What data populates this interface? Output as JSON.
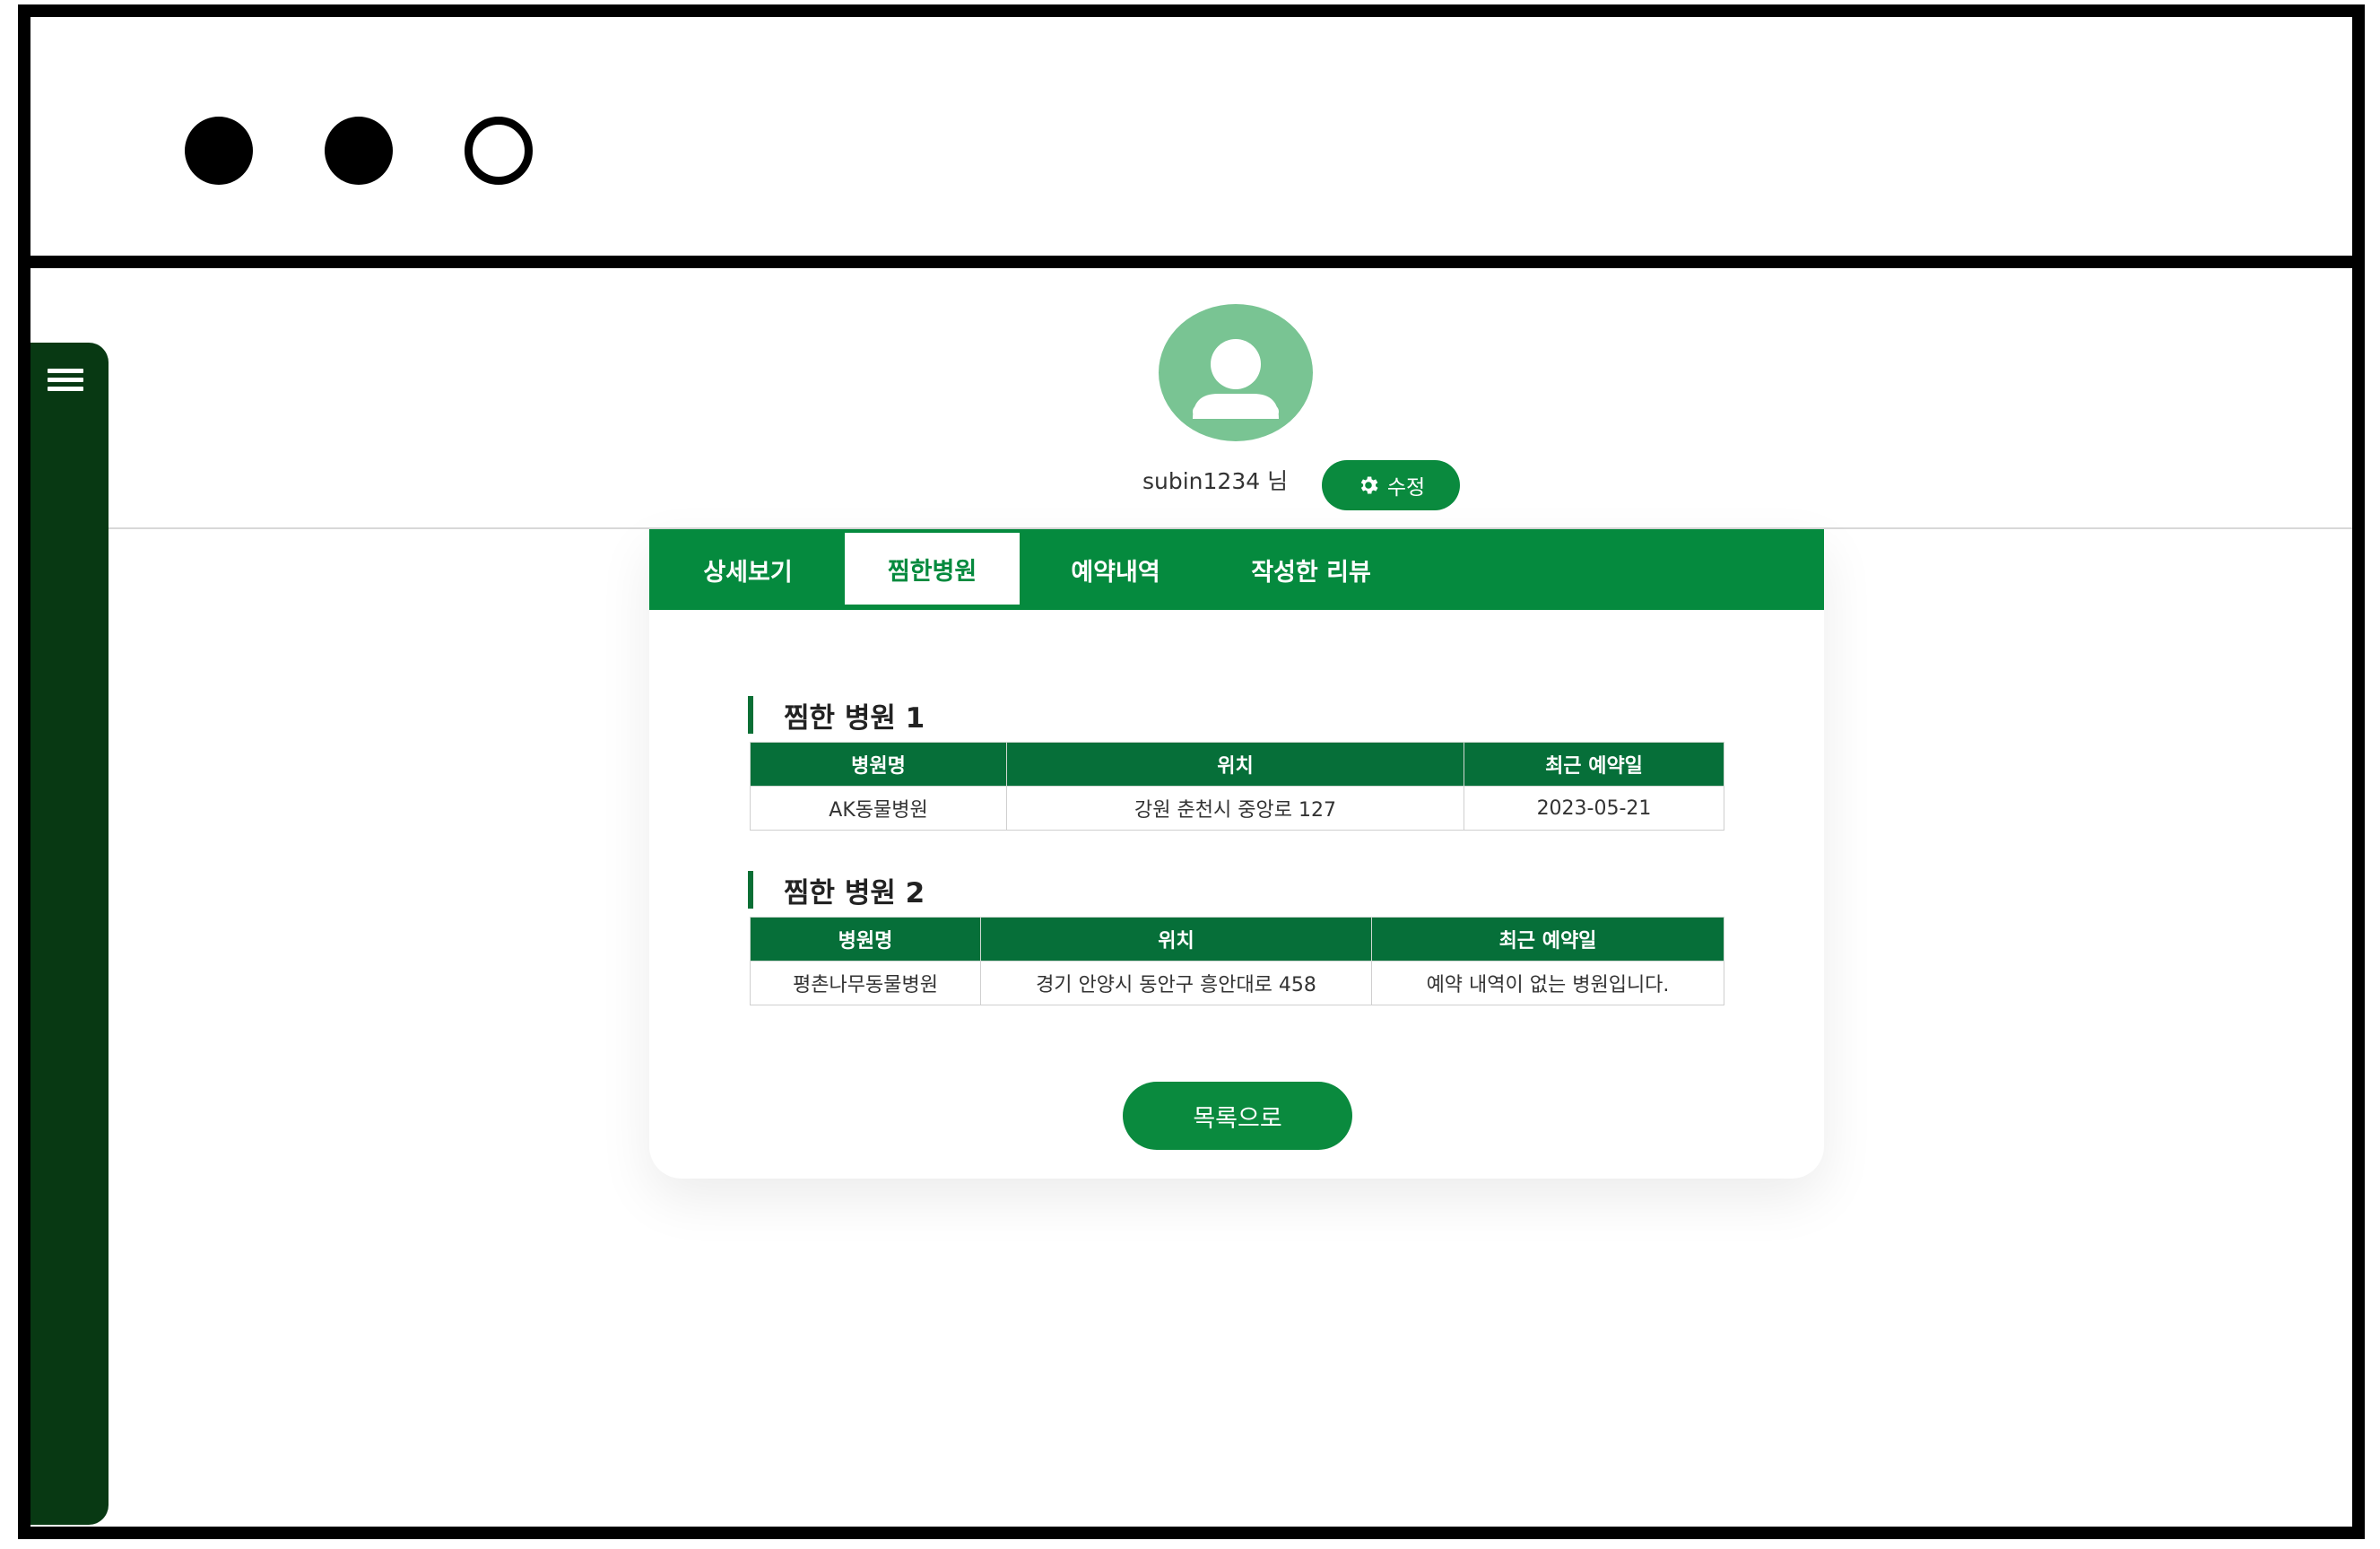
{
  "profile": {
    "username": "subin1234 님",
    "edit_label": "수정"
  },
  "tabs": [
    {
      "label": "상세보기",
      "active": false
    },
    {
      "label": "찜한병원",
      "active": true
    },
    {
      "label": "예약내역",
      "active": false
    },
    {
      "label": "작성한 리뷰",
      "active": false
    }
  ],
  "favorites": [
    {
      "title": "찜한 병원 1",
      "headers": [
        "병원명",
        "위치",
        "최근 예약일"
      ],
      "row": [
        "AK동물병원",
        "강원 춘천시 중앙로 127",
        "2023-05-21"
      ]
    },
    {
      "title": "찜한 병원 2",
      "headers": [
        "병원명",
        "위치",
        "최근 예약일"
      ],
      "row": [
        "평촌나무동물병원",
        "경기 안양시 동안구 흥안대로 458",
        "예약 내역이 없는 병원입니다."
      ]
    }
  ],
  "list_button_label": "목록으로",
  "colors": {
    "primary": "#058a3e",
    "header_dark": "#066f39",
    "sidebar": "#083913",
    "avatar": "#79c493"
  }
}
